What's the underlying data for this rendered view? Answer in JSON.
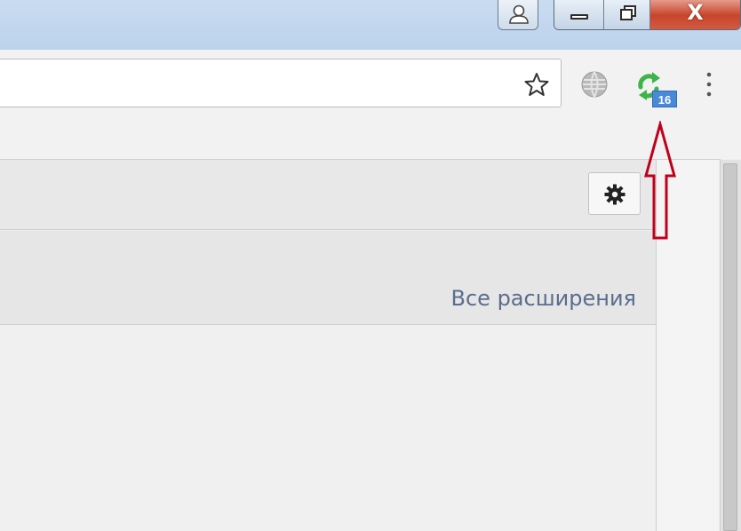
{
  "extension_badge": {
    "count": "16"
  },
  "subheader": {
    "all_extensions_link": "Все расширения"
  },
  "icons": {
    "profile": "user-icon",
    "minimize": "minimize-icon",
    "maximize": "restore-icon",
    "close": "close-icon",
    "bookmark": "star-icon",
    "globe": "globe-icon",
    "extension": "refresh-extension-icon",
    "menu": "kebab-menu-icon",
    "settings": "gear-icon",
    "annotation": "red-up-arrow"
  },
  "colors": {
    "titlebar": "#c9dcf1",
    "close_button": "#c8452c",
    "badge": "#4a89d8",
    "link": "#5a6d8e",
    "annotation_arrow": "#c0001a",
    "extension_icon": "#3cb44a"
  },
  "window_controls": {
    "close_glyph": "X"
  }
}
